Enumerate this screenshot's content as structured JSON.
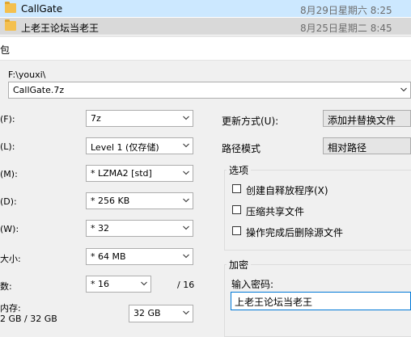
{
  "file_list": [
    {
      "name": "CallGate",
      "date": "8月29日星期六 8:25"
    },
    {
      "name": "上老王论坛当老王",
      "date": "8月25日星期二 8:45"
    }
  ],
  "dialog_title": "包",
  "archive": {
    "path_label": "F:\\youxi\\",
    "filename": "CallGate.7z"
  },
  "left_settings": {
    "format": {
      "label": "(F):",
      "value": "7z"
    },
    "level": {
      "label": "(L):",
      "value": "Level 1 (仅存储)"
    },
    "method": {
      "label": "(M):",
      "value": "* LZMA2 [std]"
    },
    "dictionary": {
      "label": "(D):",
      "value": "* 256 KB"
    },
    "word_size": {
      "label": "(W):",
      "value": "* 32"
    },
    "solid_block": {
      "label": "大小:",
      "value": "* 64 MB"
    },
    "threads": {
      "label": "数:",
      "value": "* 16",
      "max": "/ 16"
    },
    "memory": {
      "label": "内存:",
      "sublabel": "2 GB / 32 GB",
      "value": "32 GB"
    }
  },
  "right_settings": {
    "update_mode": {
      "label": "更新方式(U):",
      "value": "添加并替换文件"
    },
    "path_mode": {
      "label": "路径模式",
      "value": "相对路径"
    },
    "options": {
      "title": "选项",
      "items": [
        {
          "label": "创建自释放程序(X)",
          "checked": false
        },
        {
          "label": "压缩共享文件",
          "checked": false
        },
        {
          "label": "操作完成后删除源文件",
          "checked": false
        }
      ]
    },
    "encryption": {
      "title": "加密",
      "password_label": "输入密码:",
      "password_value": "上老王论坛当老王"
    }
  }
}
